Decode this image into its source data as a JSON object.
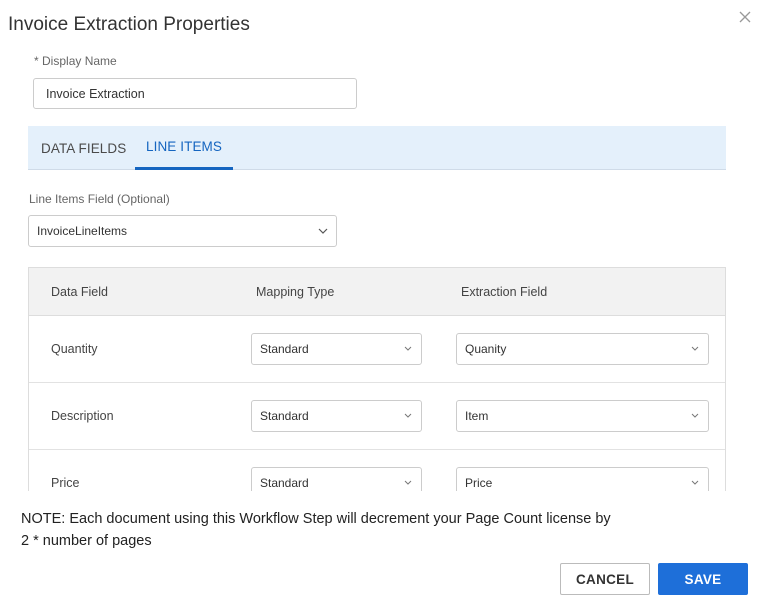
{
  "dialog": {
    "title": "Invoice Extraction Properties"
  },
  "display_name": {
    "required_marker": "*",
    "label": "Display Name",
    "value": "Invoice Extraction"
  },
  "tabs": [
    {
      "label": "DATA FIELDS",
      "active": false
    },
    {
      "label": "LINE ITEMS",
      "active": true
    }
  ],
  "line_items_field": {
    "label": "Line Items Field (Optional)",
    "value": "InvoiceLineItems"
  },
  "table": {
    "headers": [
      "Data Field",
      "Mapping Type",
      "Extraction Field"
    ],
    "rows": [
      {
        "data_field": "Quantity",
        "mapping_type": "Standard",
        "extraction_field": "Quanity"
      },
      {
        "data_field": "Description",
        "mapping_type": "Standard",
        "extraction_field": "Item"
      },
      {
        "data_field": "Price",
        "mapping_type": "Standard",
        "extraction_field": "Price"
      }
    ]
  },
  "note": {
    "line1": "NOTE: Each document using this Workflow Step will decrement your Page Count license by",
    "line2": "2 * number of pages"
  },
  "buttons": {
    "cancel": "CANCEL",
    "save": "SAVE"
  },
  "icons": {
    "close": "close-icon",
    "dropdown": "chevron-down-icon"
  },
  "colors": {
    "accent": "#1565c0",
    "save_button": "#1e6fd9",
    "tab_bar": "#e4f0fb"
  }
}
